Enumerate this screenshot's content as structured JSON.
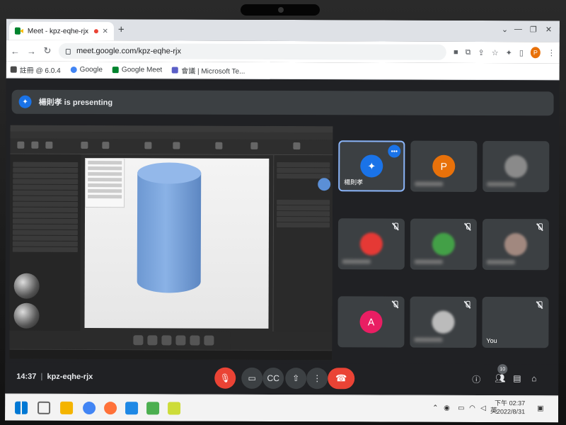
{
  "browser": {
    "tab_title": "Meet - kpz-eqhe-rjx",
    "url": "meet.google.com/kpz-eqhe-rjx",
    "profile_initial": "P",
    "bookmarks": [
      "註冊 @ 6.0.4",
      "Google",
      "Google Meet",
      "會議 | Microsoft Te..."
    ]
  },
  "meet": {
    "presenter_text": "楊則孝 is presenting",
    "participants": [
      {
        "name": "楊則孝",
        "initial": "",
        "color": "#1a73e8"
      },
      {
        "name": "",
        "initial": "P",
        "color": "#e8710a"
      },
      {
        "name": "",
        "initial": "",
        "color": "#8a8a8a"
      },
      {
        "name": "",
        "initial": "",
        "color": "#e53935"
      },
      {
        "name": "",
        "initial": "",
        "color": "#43a047"
      },
      {
        "name": "",
        "initial": "",
        "color": "#a1887f"
      },
      {
        "name": "",
        "initial": "A",
        "color": "#e91e63"
      },
      {
        "name": "",
        "initial": "",
        "color": "#bbbbbb"
      },
      {
        "name": "You",
        "initial": "",
        "color": "#3c4043"
      }
    ],
    "time": "14:37",
    "meeting_code": "kpz-eqhe-rjx",
    "participant_count": "10"
  },
  "system": {
    "time": "下午 02:37",
    "date": "2022/8/31",
    "lang": "英"
  }
}
